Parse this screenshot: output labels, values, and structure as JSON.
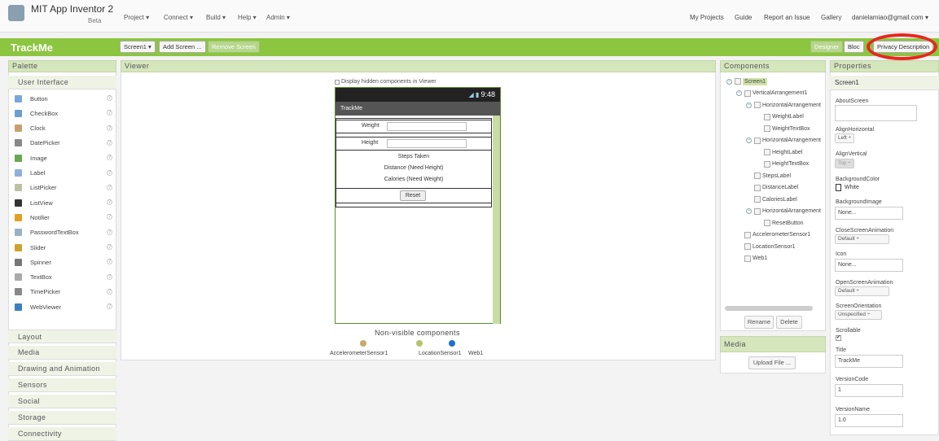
{
  "header": {
    "app_title": "MIT App Inventor 2",
    "beta": "Beta",
    "menus": [
      "Project ▾",
      "Connect ▾",
      "Build ▾",
      "Help ▾",
      "Admin ▾"
    ],
    "right_links": [
      "My Projects",
      "Guide",
      "Report an Issue",
      "Gallery",
      "danielamiao@gmail.com ▾"
    ]
  },
  "toolbar": {
    "project_name": "TrackMe",
    "screen_select": "Screen1 ▾",
    "add_screen": "Add Screen ...",
    "remove_screen": "Remove Screen",
    "designer": "Designer",
    "blocks": "Bloc",
    "privacy": "Privacy Description"
  },
  "palette": {
    "title": "Palette",
    "user_interface": "User Interface",
    "items": [
      {
        "label": "Button",
        "color": "#7aa7d8"
      },
      {
        "label": "CheckBox",
        "color": "#6a9fd0"
      },
      {
        "label": "Clock",
        "color": "#c8a070"
      },
      {
        "label": "DatePicker",
        "color": "#888888"
      },
      {
        "label": "Image",
        "color": "#6aa84f"
      },
      {
        "label": "Label",
        "color": "#8fb0d8"
      },
      {
        "label": "ListPicker",
        "color": "#c0c0a0"
      },
      {
        "label": "ListView",
        "color": "#333333"
      },
      {
        "label": "Notifier",
        "color": "#e0a020"
      },
      {
        "label": "PasswordTextBox",
        "color": "#9ab0c8"
      },
      {
        "label": "Slider",
        "color": "#d0a030"
      },
      {
        "label": "Spinner",
        "color": "#777777"
      },
      {
        "label": "TextBox",
        "color": "#aaaaaa"
      },
      {
        "label": "TimePicker",
        "color": "#888888"
      },
      {
        "label": "WebViewer",
        "color": "#3a7fc0"
      }
    ],
    "help_glyph": "?",
    "categories": [
      "Layout",
      "Media",
      "Drawing and Animation",
      "Sensors",
      "Social",
      "Storage",
      "Connectivity"
    ]
  },
  "viewer": {
    "title": "Viewer",
    "hidden_checkbox": "Display hidden components in Viewer",
    "status_time": "9:48",
    "phone_title": "TrackMe",
    "weight_label": "Weight",
    "height_label": "Height",
    "steps": "Steps Taken",
    "distance": "Distance (Need Height)",
    "calories": "Calories (Need Weight)",
    "reset": "Reset",
    "nonvisible_title": "Non-visible components",
    "nonvisible_labels": [
      "AccelerometerSensor1",
      "LocationSensor1",
      "Web1"
    ]
  },
  "components": {
    "title": "Components",
    "tree": [
      {
        "label": "Screen1",
        "level": 0,
        "toggle": true,
        "selected": true
      },
      {
        "label": "VerticalArrangement1",
        "level": 1,
        "toggle": true
      },
      {
        "label": "HorizontalArrangement",
        "level": 2,
        "toggle": true
      },
      {
        "label": "WeightLabel",
        "level": 3
      },
      {
        "label": "WeightTextBox",
        "level": 3
      },
      {
        "label": "HorizontalArrangement",
        "level": 2,
        "toggle": true
      },
      {
        "label": "HeightLabel",
        "level": 3
      },
      {
        "label": "HeightTextBox",
        "level": 3
      },
      {
        "label": "StepsLabel",
        "level": 2
      },
      {
        "label": "DistanceLabel",
        "level": 2
      },
      {
        "label": "CaloriesLabel",
        "level": 2
      },
      {
        "label": "HorizontalArrangement",
        "level": 2,
        "toggle": true
      },
      {
        "label": "ResetButton",
        "level": 3
      },
      {
        "label": "AccelerometerSensor1",
        "level": 1
      },
      {
        "label": "LocationSensor1",
        "level": 1
      },
      {
        "label": "Web1",
        "level": 1
      }
    ],
    "toggle_glyph": "−",
    "rename": "Rename",
    "delete": "Delete"
  },
  "media": {
    "title": "Media",
    "upload": "Upload File ..."
  },
  "properties": {
    "title": "Properties",
    "component": "Screen1",
    "about_label": "AboutScreen",
    "align_h_label": "AlignHorizontal",
    "align_h_value": "Left ÷",
    "align_v_label": "AlignVertical",
    "align_v_value": "Top ÷",
    "bgcolor_label": "BackgroundColor",
    "bgcolor_value": "White",
    "bgimage_label": "BackgroundImage",
    "bgimage_value": "None...",
    "close_anim_label": "CloseScreenAnimation",
    "close_anim_value": "Default ÷",
    "icon_label": "Icon",
    "icon_value": "None...",
    "open_anim_label": "OpenScreenAnimation",
    "open_anim_value": "Default ÷",
    "orientation_label": "ScreenOrientation",
    "orientation_value": "Unspecified ÷",
    "scrollable_label": "Scrollable",
    "scrollable_check": "✔",
    "title_label": "Title",
    "title_value": "TrackMe",
    "vcode_label": "VersionCode",
    "vcode_value": "1",
    "vname_label": "VersionName",
    "vname_value": "1.0"
  }
}
